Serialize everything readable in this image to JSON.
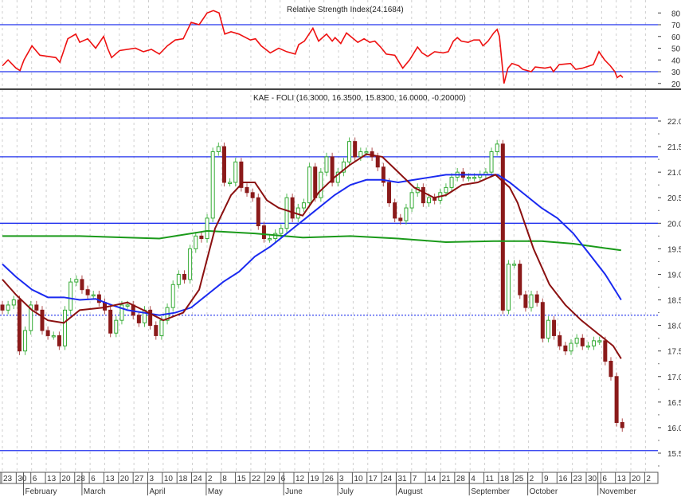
{
  "chart_data": [
    {
      "type": "line",
      "title": "Relative Strength Index",
      "title_value": "(24.1684)",
      "ylim": [
        15,
        87
      ],
      "yticks": [
        "80",
        "70",
        "60",
        "50",
        "40",
        "30",
        "20"
      ],
      "ytick_values": [
        80,
        70,
        60,
        50,
        40,
        30,
        20
      ],
      "reference_lines": [
        70,
        30
      ],
      "series": [
        {
          "name": "RSI",
          "color": "#ee1111",
          "points": [
            [
              0,
              35
            ],
            [
              1,
              40
            ],
            [
              2.4,
              33
            ],
            [
              3.1,
              31
            ],
            [
              3.8,
              40
            ],
            [
              5.2,
              52
            ],
            [
              6.6,
              44
            ],
            [
              9.4,
              42
            ],
            [
              10.1,
              38
            ],
            [
              11.5,
              58
            ],
            [
              12.9,
              62
            ],
            [
              13.6,
              55
            ],
            [
              15,
              58
            ],
            [
              16.4,
              50
            ],
            [
              17.8,
              60
            ],
            [
              18.5,
              50
            ],
            [
              19.2,
              42
            ],
            [
              20.6,
              48
            ],
            [
              23.4,
              50
            ],
            [
              24.8,
              47
            ],
            [
              26.2,
              49
            ],
            [
              27.6,
              45
            ],
            [
              29,
              52
            ],
            [
              30.4,
              57
            ],
            [
              31.8,
              58
            ],
            [
              33.2,
              72
            ],
            [
              34.6,
              70
            ],
            [
              36,
              80
            ],
            [
              37.1,
              82
            ],
            [
              38.1,
              80
            ],
            [
              39.1,
              62
            ],
            [
              40.2,
              64
            ],
            [
              41.6,
              62
            ],
            [
              43.6,
              57
            ],
            [
              44.5,
              58
            ],
            [
              45.5,
              52
            ],
            [
              47.1,
              46
            ],
            [
              48.6,
              50
            ],
            [
              50,
              47
            ],
            [
              51.5,
              45
            ],
            [
              52.1,
              53
            ],
            [
              53.1,
              56
            ],
            [
              54.6,
              67
            ],
            [
              55.6,
              56
            ],
            [
              57,
              62
            ],
            [
              58,
              56
            ],
            [
              58.5,
              59
            ],
            [
              59.5,
              54
            ],
            [
              60.5,
              63
            ],
            [
              61.5,
              59
            ],
            [
              62.5,
              55
            ],
            [
              63.6,
              58
            ],
            [
              64.6,
              55
            ],
            [
              65.5,
              56
            ],
            [
              66.5,
              51
            ],
            [
              67.5,
              45
            ],
            [
              69,
              44
            ],
            [
              70.4,
              33
            ],
            [
              71.6,
              40
            ],
            [
              73,
              51
            ],
            [
              73.8,
              46
            ],
            [
              74.8,
              43
            ],
            [
              76,
              47
            ],
            [
              77.5,
              46
            ],
            [
              78.4,
              47
            ],
            [
              79.3,
              56
            ],
            [
              80,
              59
            ],
            [
              80.7,
              56
            ],
            [
              81.9,
              55
            ],
            [
              82.9,
              57
            ],
            [
              83.9,
              57
            ],
            [
              84.5,
              52
            ],
            [
              85.4,
              56
            ],
            [
              86.4,
              63
            ],
            [
              87,
              66
            ],
            [
              87.4,
              60
            ],
            [
              88.2,
              20
            ],
            [
              88.9,
              33
            ],
            [
              89.6,
              37
            ],
            [
              90.8,
              35
            ],
            [
              91.5,
              32
            ],
            [
              93,
              30
            ],
            [
              93.7,
              34
            ],
            [
              95.4,
              33
            ],
            [
              96.4,
              34
            ],
            [
              96.9,
              30
            ],
            [
              97.9,
              36
            ],
            [
              99.9,
              37
            ],
            [
              100.8,
              32
            ],
            [
              102,
              33
            ],
            [
              103.9,
              36
            ],
            [
              104.9,
              47
            ],
            [
              105.9,
              40
            ],
            [
              106.9,
              35
            ],
            [
              107.7,
              30
            ],
            [
              108.1,
              25
            ],
            [
              108.7,
              27
            ],
            [
              109.1,
              25
            ]
          ]
        }
      ]
    },
    {
      "type": "candlestick",
      "title": "KAE - FOLI (16.3000, 16.3500, 15.8300, 16.0000, -0.20000)",
      "ylim": [
        15.4,
        22.3
      ],
      "yticks": [
        "22.0",
        "21.5",
        "21.0",
        "20.5",
        "20.0",
        "19.5",
        "19.0",
        "18.5",
        "18.0",
        "17.5",
        "17.0",
        "16.5",
        "16.0",
        "15.5"
      ],
      "ytick_values": [
        22.0,
        21.5,
        21.0,
        20.5,
        20.0,
        19.5,
        19.0,
        18.5,
        18.0,
        17.5,
        17.0,
        16.5,
        16.0,
        15.5
      ],
      "reference_lines": [
        22.06,
        21.3,
        20.0,
        15.55
      ],
      "dotted_lines": [
        18.2
      ],
      "up_color": "#33aa33",
      "down_color": "#8b1a1a",
      "closes": [
        18.3,
        18.4,
        18.5,
        17.5,
        17.9,
        18.4,
        18.3,
        17.9,
        17.8,
        17.8,
        17.6,
        18.3,
        18.85,
        18.9,
        18.7,
        18.6,
        18.6,
        18.45,
        18.3,
        17.85,
        18.1,
        18.4,
        18.4,
        18.2,
        18.05,
        18.3,
        18.0,
        17.8,
        18.1,
        18.35,
        18.8,
        19.0,
        18.9,
        19.5,
        19.75,
        19.7,
        20.1,
        21.4,
        21.5,
        20.8,
        20.8,
        21.2,
        20.7,
        20.6,
        20.5,
        19.95,
        19.7,
        19.7,
        19.8,
        19.9,
        20.5,
        20.1,
        20.3,
        20.4,
        21.1,
        20.5,
        21.0,
        21.3,
        20.8,
        21.0,
        21.2,
        21.6,
        21.3,
        21.4,
        21.4,
        21.3,
        21.1,
        20.8,
        20.4,
        20.1,
        20.05,
        20.3,
        20.6,
        20.7,
        20.4,
        20.5,
        20.45,
        20.6,
        20.7,
        20.9,
        21.0,
        20.9,
        20.9,
        20.9,
        20.95,
        21.0,
        21.4,
        21.55,
        18.3,
        19.2,
        19.2,
        18.6,
        18.35,
        18.6,
        18.45,
        17.75,
        18.1,
        17.8,
        17.6,
        17.5,
        17.65,
        17.75,
        17.6,
        17.6,
        17.7,
        17.7,
        17.3,
        17.0,
        16.1,
        16.0
      ],
      "series": [
        {
          "name": "Short moving average",
          "color": "#8b1010",
          "points": [
            [
              0,
              18.9
            ],
            [
              2.4,
              18.6
            ],
            [
              5.2,
              18.3
            ],
            [
              8,
              18.1
            ],
            [
              10.8,
              18.05
            ],
            [
              13.6,
              18.3
            ],
            [
              17.8,
              18.35
            ],
            [
              22,
              18.45
            ],
            [
              24.8,
              18.3
            ],
            [
              28.3,
              18.1
            ],
            [
              31.8,
              18.25
            ],
            [
              34.6,
              18.7
            ],
            [
              37.4,
              19.9
            ],
            [
              40.2,
              20.55
            ],
            [
              42.3,
              20.8
            ],
            [
              44.4,
              20.8
            ],
            [
              46.5,
              20.45
            ],
            [
              48.6,
              20.3
            ],
            [
              52.8,
              20.15
            ],
            [
              55.6,
              20.6
            ],
            [
              58.4,
              20.9
            ],
            [
              61.2,
              21.15
            ],
            [
              64,
              21.35
            ],
            [
              66.8,
              21.3
            ],
            [
              69.6,
              21.0
            ],
            [
              72.4,
              20.7
            ],
            [
              75.9,
              20.5
            ],
            [
              78,
              20.55
            ],
            [
              80.8,
              20.75
            ],
            [
              83.6,
              20.8
            ],
            [
              86.7,
              20.95
            ],
            [
              89.2,
              20.7
            ],
            [
              90.6,
              20.4
            ],
            [
              93.4,
              19.5
            ],
            [
              96.2,
              18.8
            ],
            [
              97.6,
              18.6
            ],
            [
              99,
              18.4
            ],
            [
              101.8,
              18.1
            ],
            [
              104.6,
              17.85
            ],
            [
              107.4,
              17.6
            ],
            [
              108.8,
              17.35
            ]
          ]
        },
        {
          "name": "Medium moving average",
          "color": "#1a2af0",
          "points": [
            [
              0,
              19.2
            ],
            [
              2.4,
              18.95
            ],
            [
              5.2,
              18.7
            ],
            [
              8,
              18.55
            ],
            [
              10.8,
              18.55
            ],
            [
              13.6,
              18.5
            ],
            [
              16.4,
              18.52
            ],
            [
              19.2,
              18.4
            ],
            [
              22,
              18.3
            ],
            [
              24.8,
              18.25
            ],
            [
              27.6,
              18.2
            ],
            [
              30.4,
              18.25
            ],
            [
              33.2,
              18.35
            ],
            [
              36,
              18.6
            ],
            [
              38.8,
              18.85
            ],
            [
              41.6,
              19.05
            ],
            [
              44.4,
              19.35
            ],
            [
              47.2,
              19.55
            ],
            [
              50,
              19.8
            ],
            [
              52.8,
              20.05
            ],
            [
              55.6,
              20.3
            ],
            [
              58.4,
              20.55
            ],
            [
              61.2,
              20.75
            ],
            [
              64,
              20.85
            ],
            [
              66.8,
              20.85
            ],
            [
              69.6,
              20.8
            ],
            [
              72.4,
              20.85
            ],
            [
              75.2,
              20.9
            ],
            [
              78,
              20.95
            ],
            [
              80.8,
              20.95
            ],
            [
              83.6,
              20.95
            ],
            [
              87.1,
              20.95
            ],
            [
              89.2,
              20.8
            ],
            [
              92,
              20.55
            ],
            [
              94.8,
              20.3
            ],
            [
              97.6,
              20.1
            ],
            [
              100.4,
              19.8
            ],
            [
              103.2,
              19.4
            ],
            [
              106,
              19.0
            ],
            [
              108.8,
              18.5
            ]
          ]
        },
        {
          "name": "Long moving average",
          "color": "#1a9a1a",
          "points": [
            [
              0,
              19.75
            ],
            [
              13.6,
              19.75
            ],
            [
              27.6,
              19.7
            ],
            [
              36,
              19.85
            ],
            [
              44.4,
              19.8
            ],
            [
              52.8,
              19.72
            ],
            [
              61.2,
              19.75
            ],
            [
              69.6,
              19.7
            ],
            [
              78,
              19.63
            ],
            [
              86.4,
              19.65
            ],
            [
              94.8,
              19.65
            ],
            [
              100.4,
              19.6
            ],
            [
              108.8,
              19.47
            ]
          ]
        }
      ],
      "x_tick_labels": [
        "23",
        "30",
        "6",
        "13",
        "20",
        "28",
        "6",
        "13",
        "20",
        "27",
        "3",
        "10",
        "18",
        "24",
        "2",
        "8",
        "15",
        "22",
        "29",
        "6",
        "12",
        "19",
        "26",
        "3",
        "10",
        "17",
        "24",
        "31",
        "7",
        "14",
        "21",
        "28",
        "4",
        "11",
        "18",
        "25",
        "2",
        "9",
        "16",
        "23",
        "30",
        "6",
        "13",
        "20",
        "2"
      ],
      "months": [
        "February",
        "March",
        "April",
        "May",
        "June",
        "July",
        "August",
        "September",
        "October",
        "November"
      ]
    }
  ]
}
